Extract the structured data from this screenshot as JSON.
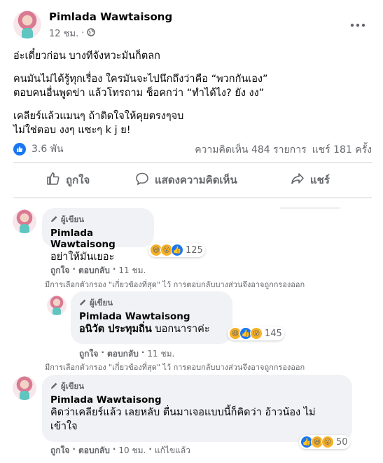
{
  "post": {
    "author": "Pimlada Wawtaisong",
    "time": "12 ชม.",
    "dot": "·",
    "lines": [
      "อ่ะเดี๋ยวก่อน บางทีจังหวะมันก็ตลก",
      "คนมันไม่ได้รู้ทุกเรื่อง ใครมันจะไปนึกถึงว่าคือ “พวกกันเอง”",
      "ตอบคนอื่นพูดข่า แล้วโทรถาม ช็อคกว่า “ทำได้ไง? ยัง งง”",
      "เคลียร์แล้วแมนๆ ถ้าติดใจให้คุยตรงๆจบ",
      "ไม่ใช่ตอบ งงๆ แซะๆ k j ย!"
    ],
    "reaction_count": "3.6 พัน",
    "comments_count": "ความคิดเห็น 484 รายการ",
    "shares_count": "แชร์ 181 ครั้ง",
    "actions": {
      "like": "ถูกใจ",
      "comment": "แสดงความคิดเห็น",
      "share": "แชร์"
    }
  },
  "comments": [
    {
      "badge": "ผู้เขียน",
      "name": "Pimlada Wawtaisong",
      "text": "อย่าให้มันเยอะ",
      "reactions": "125",
      "like": "ถูกใจ",
      "reply": "ตอบกลับ",
      "time": "11 ชม.",
      "note": "มีการเลือกตัวกรอง \"เกี่ยวข้องที่สุด\" ไว้ การตอบกลับบางส่วนจึงอาจถูกกรองออก"
    },
    {
      "badge": "ผู้เขียน",
      "name": "Pimlada Wawtaisong",
      "mention": "อนิวัต ประทุมถิ่น",
      "text": "บอกนาราค่ะ",
      "reactions": "145",
      "like": "ถูกใจ",
      "reply": "ตอบกลับ",
      "time": "11 ชม.",
      "note": "มีการเลือกตัวกรอง \"เกี่ยวข้องที่สุด\" ไว้ การตอบกลับบางส่วนจึงอาจถูกกรองออก"
    },
    {
      "badge": "ผู้เขียน",
      "name": "Pimlada Wawtaisong",
      "text": "คิดว่าเคลียร์แล้ว เลยหลับ ตื่นมาเจอแบบนี้ก็คิดว่า อ้าวน้อง ไม่เข้าใจ",
      "reactions": "50",
      "like": "ถูกใจ",
      "reply": "ตอบกลับ",
      "time": "10 ชม.",
      "edited": "แก้ไขแล้ว"
    }
  ],
  "colors": {
    "accent": "#1877f2",
    "muted": "#65676b",
    "bubble": "#f0f2f5"
  }
}
